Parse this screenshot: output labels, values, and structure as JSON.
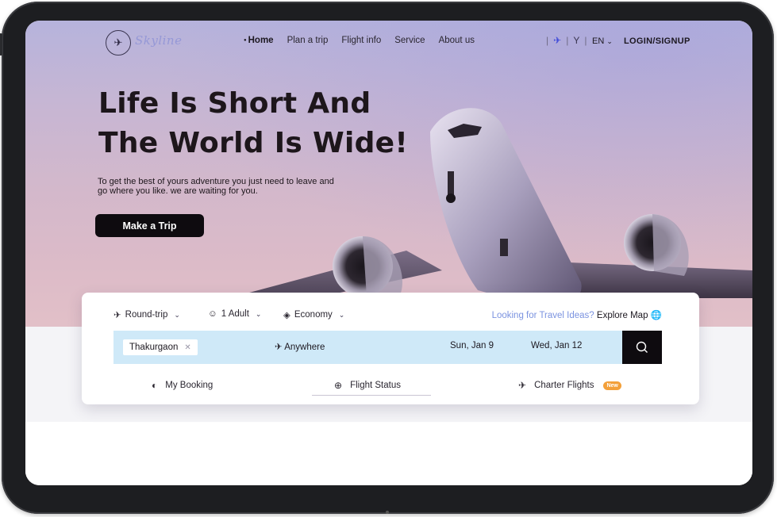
{
  "brand": {
    "logo_glyph": "✈",
    "name": "Skyline"
  },
  "nav": {
    "links": [
      {
        "label": "Home",
        "active": true
      },
      {
        "label": "Plan a trip"
      },
      {
        "label": "Flight info"
      },
      {
        "label": "Service"
      },
      {
        "label": "About us"
      }
    ],
    "icons": [
      "plane-icon",
      "antenna-icon"
    ],
    "language": "EN",
    "login": "LOGIN/SIGNUP"
  },
  "hero": {
    "headline_line1": "Life Is Short And",
    "headline_line2": "The World Is Wide!",
    "subtext_line1": "To get the best of yours adventure you just need to leave and",
    "subtext_line2": "go where you like. we are waiting for you.",
    "cta": "Make a Trip"
  },
  "search": {
    "trip_type": "Round-trip",
    "passengers": "1 Adult",
    "cabin": "Economy",
    "ideas_question": "Looking for Travel Ideas?",
    "ideas_link": "Explore Map",
    "from": "Thakurgaon",
    "to": "Anywhere",
    "depart": "Sun, Jan 9",
    "return": "Wed, Jan 12"
  },
  "tabs": {
    "my_booking": "My Booking",
    "flight_status": "Flight Status",
    "charter_flights": "Charter Flights",
    "new_badge": "New"
  },
  "colors": {
    "accent_blue": "#3d49d9",
    "search_bar": "#cfe9f8",
    "dark": "#0e0b0f",
    "badge": "#f3a03a"
  }
}
